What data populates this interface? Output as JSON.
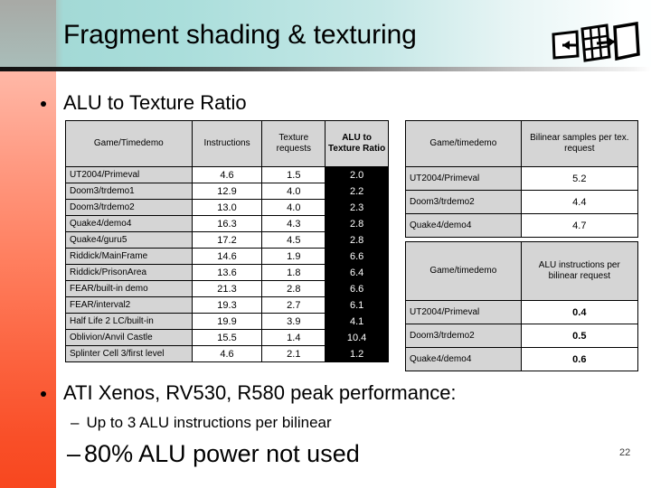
{
  "slide": {
    "title": "Fragment shading & texturing",
    "title_icon": "texture-mapping-icon",
    "page_number": "22",
    "accent_color": "#f8471f",
    "header_color": "#a3d9d6"
  },
  "bullets": {
    "b1": "ALU to Texture Ratio",
    "b2": "ATI Xenos, RV530, R580 peak performance:",
    "b3_dash": "–",
    "b3": "Up to 3 ALU instructions per bilinear",
    "b4_dash": "–",
    "b4": "80% ALU power not used"
  },
  "table_alu": {
    "headers": [
      "Game/Timedemo",
      "Instructions",
      "Texture requests",
      "ALU to Texture Ratio"
    ],
    "rows": [
      {
        "name": "UT2004/Primeval",
        "instructions": "4.6",
        "texture_requests": "1.5",
        "ratio": "2.0"
      },
      {
        "name": "Doom3/trdemo1",
        "instructions": "12.9",
        "texture_requests": "4.0",
        "ratio": "2.2"
      },
      {
        "name": "Doom3/trdemo2",
        "instructions": "13.0",
        "texture_requests": "4.0",
        "ratio": "2.3"
      },
      {
        "name": "Quake4/demo4",
        "instructions": "16.3",
        "texture_requests": "4.3",
        "ratio": "2.8"
      },
      {
        "name": "Quake4/guru5",
        "instructions": "17.2",
        "texture_requests": "4.5",
        "ratio": "2.8"
      },
      {
        "name": "Riddick/MainFrame",
        "instructions": "14.6",
        "texture_requests": "1.9",
        "ratio": "6.6"
      },
      {
        "name": "Riddick/PrisonArea",
        "instructions": "13.6",
        "texture_requests": "1.8",
        "ratio": "6.4"
      },
      {
        "name": "FEAR/built-in demo",
        "instructions": "21.3",
        "texture_requests": "2.8",
        "ratio": "6.6"
      },
      {
        "name": "FEAR/interval2",
        "instructions": "19.3",
        "texture_requests": "2.7",
        "ratio": "6.1"
      },
      {
        "name": "Half Life 2 LC/built-in",
        "instructions": "19.9",
        "texture_requests": "3.9",
        "ratio": "4.1"
      },
      {
        "name": "Oblivion/Anvil Castle",
        "instructions": "15.5",
        "texture_requests": "1.4",
        "ratio": "10.4"
      },
      {
        "name": "Splinter Cell 3/first level",
        "instructions": "4.6",
        "texture_requests": "2.1",
        "ratio": "1.2"
      }
    ]
  },
  "table_bilinear": {
    "headers": [
      "Game/timedemo",
      "Bilinear samples per tex. request"
    ],
    "rows": [
      {
        "name": "UT2004/Primeval",
        "value": "5.2"
      },
      {
        "name": "Doom3/trdemo2",
        "value": "4.4"
      },
      {
        "name": "Quake4/demo4",
        "value": "4.7"
      }
    ]
  },
  "table_alu_per_bilinear": {
    "headers": [
      "Game/timedemo",
      "ALU  instructions per bilinear request"
    ],
    "rows": [
      {
        "name": "UT2004/Primeval",
        "value": "0.4"
      },
      {
        "name": "Doom3/trdemo2",
        "value": "0.5"
      },
      {
        "name": "Quake4/demo4",
        "value": "0.6"
      }
    ]
  }
}
